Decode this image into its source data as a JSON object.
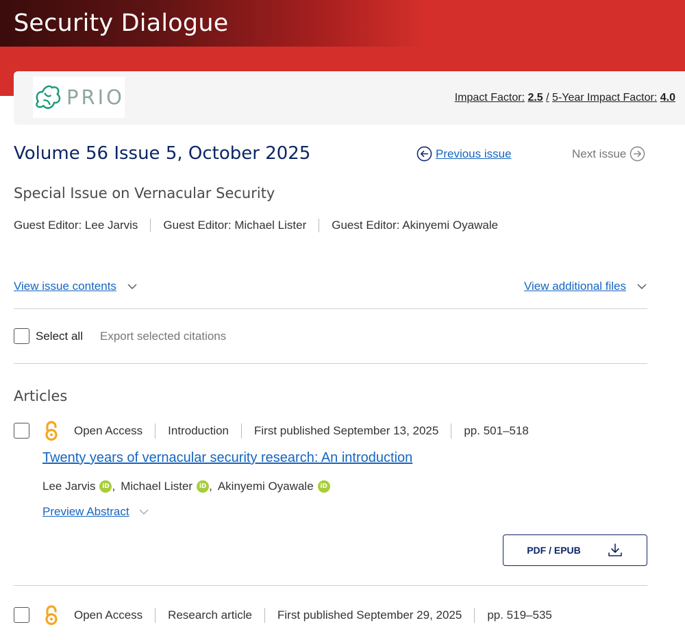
{
  "header": {
    "journal_title": "Security Dialogue",
    "brand_color": "#d42f2a",
    "logo_text": "PRIO",
    "impact_factor_label": "Impact Factor:",
    "impact_factor_value": "2.5",
    "impact_separator": "/",
    "five_year_label": "5-Year Impact Factor:",
    "five_year_value": "4.0"
  },
  "issue": {
    "title": "Volume 56 Issue 5, October 2025",
    "previous_label": "Previous issue",
    "next_label": "Next issue",
    "special_title": "Special Issue on Vernacular Security",
    "editors": [
      "Guest Editor: Lee Jarvis",
      "Guest Editor: Michael Lister",
      "Guest Editor: Akinyemi Oyawale"
    ],
    "view_contents_label": "View issue contents",
    "view_files_label": "View additional files"
  },
  "toolbar": {
    "select_all_label": "Select all",
    "export_label": "Export selected citations"
  },
  "articles_heading": "Articles",
  "articles": [
    {
      "access": "Open Access",
      "type": "Introduction",
      "published": "First published September 13, 2025",
      "pages": "pp. 501–518",
      "title": "Twenty years of vernacular security research: An introduction",
      "authors": [
        "Lee Jarvis",
        "Michael Lister",
        "Akinyemi Oyawale"
      ],
      "orcid_label": "iD",
      "preview_label": "Preview Abstract",
      "pdf_label": "PDF / EPUB"
    },
    {
      "access": "Open Access",
      "type": "Research article",
      "published": "First published September 29, 2025",
      "pages": "pp. 519–535"
    }
  ],
  "colors": {
    "link": "#1565c0",
    "navy": "#0c2566",
    "open_access": "#f5a623",
    "orcid": "#a6ce39"
  }
}
